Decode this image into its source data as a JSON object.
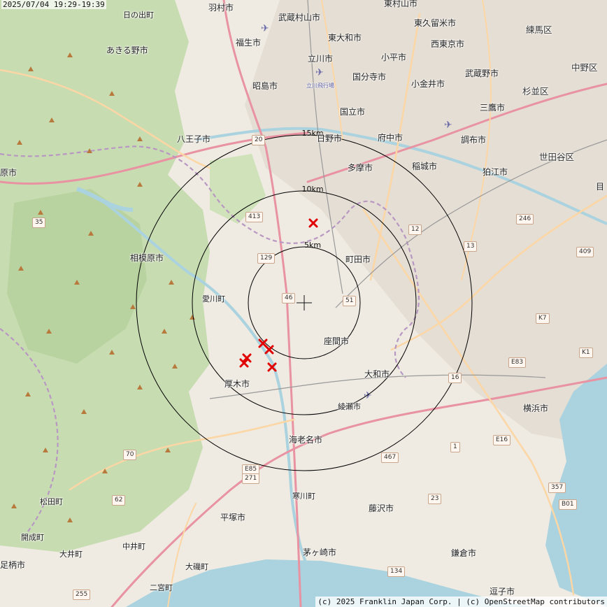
{
  "timestamp": "2025/07/04 19:29-19:39",
  "attribution": "(c) 2025 Franklin Japan Corp. | (c) OpenStreetMap contributors",
  "rings": [
    {
      "label": "5km",
      "radius_km": 5
    },
    {
      "label": "10km",
      "radius_km": 10
    },
    {
      "label": "15km",
      "radius_km": 15
    }
  ],
  "strike_count": 6,
  "places": {
    "hamura": "羽村市",
    "musashimurayama": "武蔵村山市",
    "higashimurayama": "東村山市",
    "hinode": "日の出町",
    "higashikurume": "東久留米市",
    "nerima": "練馬区",
    "fussa": "福生市",
    "higashiyamato": "東大和市",
    "nishitokyo": "西東京市",
    "akiruno": "あきる野市",
    "tachikawa": "立川市",
    "kodaira": "小平市",
    "kokubunji": "国分寺市",
    "musashino": "武蔵野市",
    "nakano": "中野区",
    "tachikawa_airfield": "立川飛行場",
    "akishima": "昭島市",
    "koganei": "小金井市",
    "suginami": "杉並区",
    "kunitachi": "国立市",
    "mitaka": "三鷹市",
    "hachioji": "八王子市",
    "hino": "日野市",
    "fuchu": "府中市",
    "chofu": "調布市",
    "tama": "多摩市",
    "inagi": "稲城市",
    "setagaya": "世田谷区",
    "hara": "原市",
    "komae": "狛江市",
    "me": "目",
    "sagamihara": "相模原市",
    "machida": "町田市",
    "aikawa": "愛川町",
    "zama": "座間市",
    "atsugi": "厚木市",
    "yamato": "大和市",
    "ayase": "綾瀬市",
    "yokohama": "横浜市",
    "ebina": "海老名市",
    "matsuda": "松田町",
    "samukawa": "寒川町",
    "fujisawa": "藤沢市",
    "kaisei": "開成町",
    "hiratsuka": "平塚市",
    "oi": "大井町",
    "nakai": "中井町",
    "minamiashigara": "足柄市",
    "chigasaki": "茅ヶ崎市",
    "kamakura": "鎌倉市",
    "oiso": "大磯町",
    "ninomiya": "二宮町",
    "zushi": "逗子市"
  },
  "routes": {
    "r20": "20",
    "r413": "413",
    "r35": "35",
    "r12": "12",
    "r129": "129",
    "r13": "13",
    "r246": "246",
    "r409": "409",
    "r46": "46",
    "r51": "51",
    "rK7": "K7",
    "rE83": "E83",
    "rK1": "K1",
    "r16": "16",
    "r70": "70",
    "rE85": "E85",
    "r271": "271",
    "r467": "467",
    "r1": "1",
    "rE16": "E16",
    "r357": "357",
    "r62": "62",
    "r23": "23",
    "rB01": "B01",
    "r134": "134",
    "r255": "255"
  }
}
